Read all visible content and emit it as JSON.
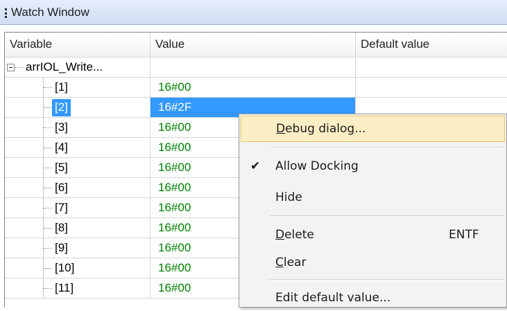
{
  "window": {
    "title": "Watch Window"
  },
  "columns": [
    "Variable",
    "Value",
    "Default value"
  ],
  "root": {
    "name": "arrIOL_Write..."
  },
  "rows": [
    {
      "index": "[1]",
      "value": "16#00"
    },
    {
      "index": "[2]",
      "value": "16#2F"
    },
    {
      "index": "[3]",
      "value": "16#00"
    },
    {
      "index": "[4]",
      "value": "16#00"
    },
    {
      "index": "[5]",
      "value": "16#00"
    },
    {
      "index": "[6]",
      "value": "16#00"
    },
    {
      "index": "[7]",
      "value": "16#00"
    },
    {
      "index": "[8]",
      "value": "16#00"
    },
    {
      "index": "[9]",
      "value": "16#00"
    },
    {
      "index": "[10]",
      "value": "16#00"
    },
    {
      "index": "[11]",
      "value": "16#00"
    }
  ],
  "selected_row_index": "[2]",
  "context_menu": {
    "debug_dialog": {
      "mnemonic": "D",
      "rest": "ebug dialog..."
    },
    "allow_docking": {
      "check": "✔",
      "label": "Allow Docking"
    },
    "hide": {
      "label": "Hide"
    },
    "delete": {
      "mnemonic": "D",
      "rest": "elete",
      "shortcut": "ENTF"
    },
    "clear": {
      "mnemonic": "C",
      "rest": "lear"
    },
    "edit_default_value": {
      "label": "Edit default value..."
    }
  },
  "colors": {
    "selection": "#3399ff",
    "value_text": "#008000",
    "menu_highlight": "#fcefc6"
  }
}
